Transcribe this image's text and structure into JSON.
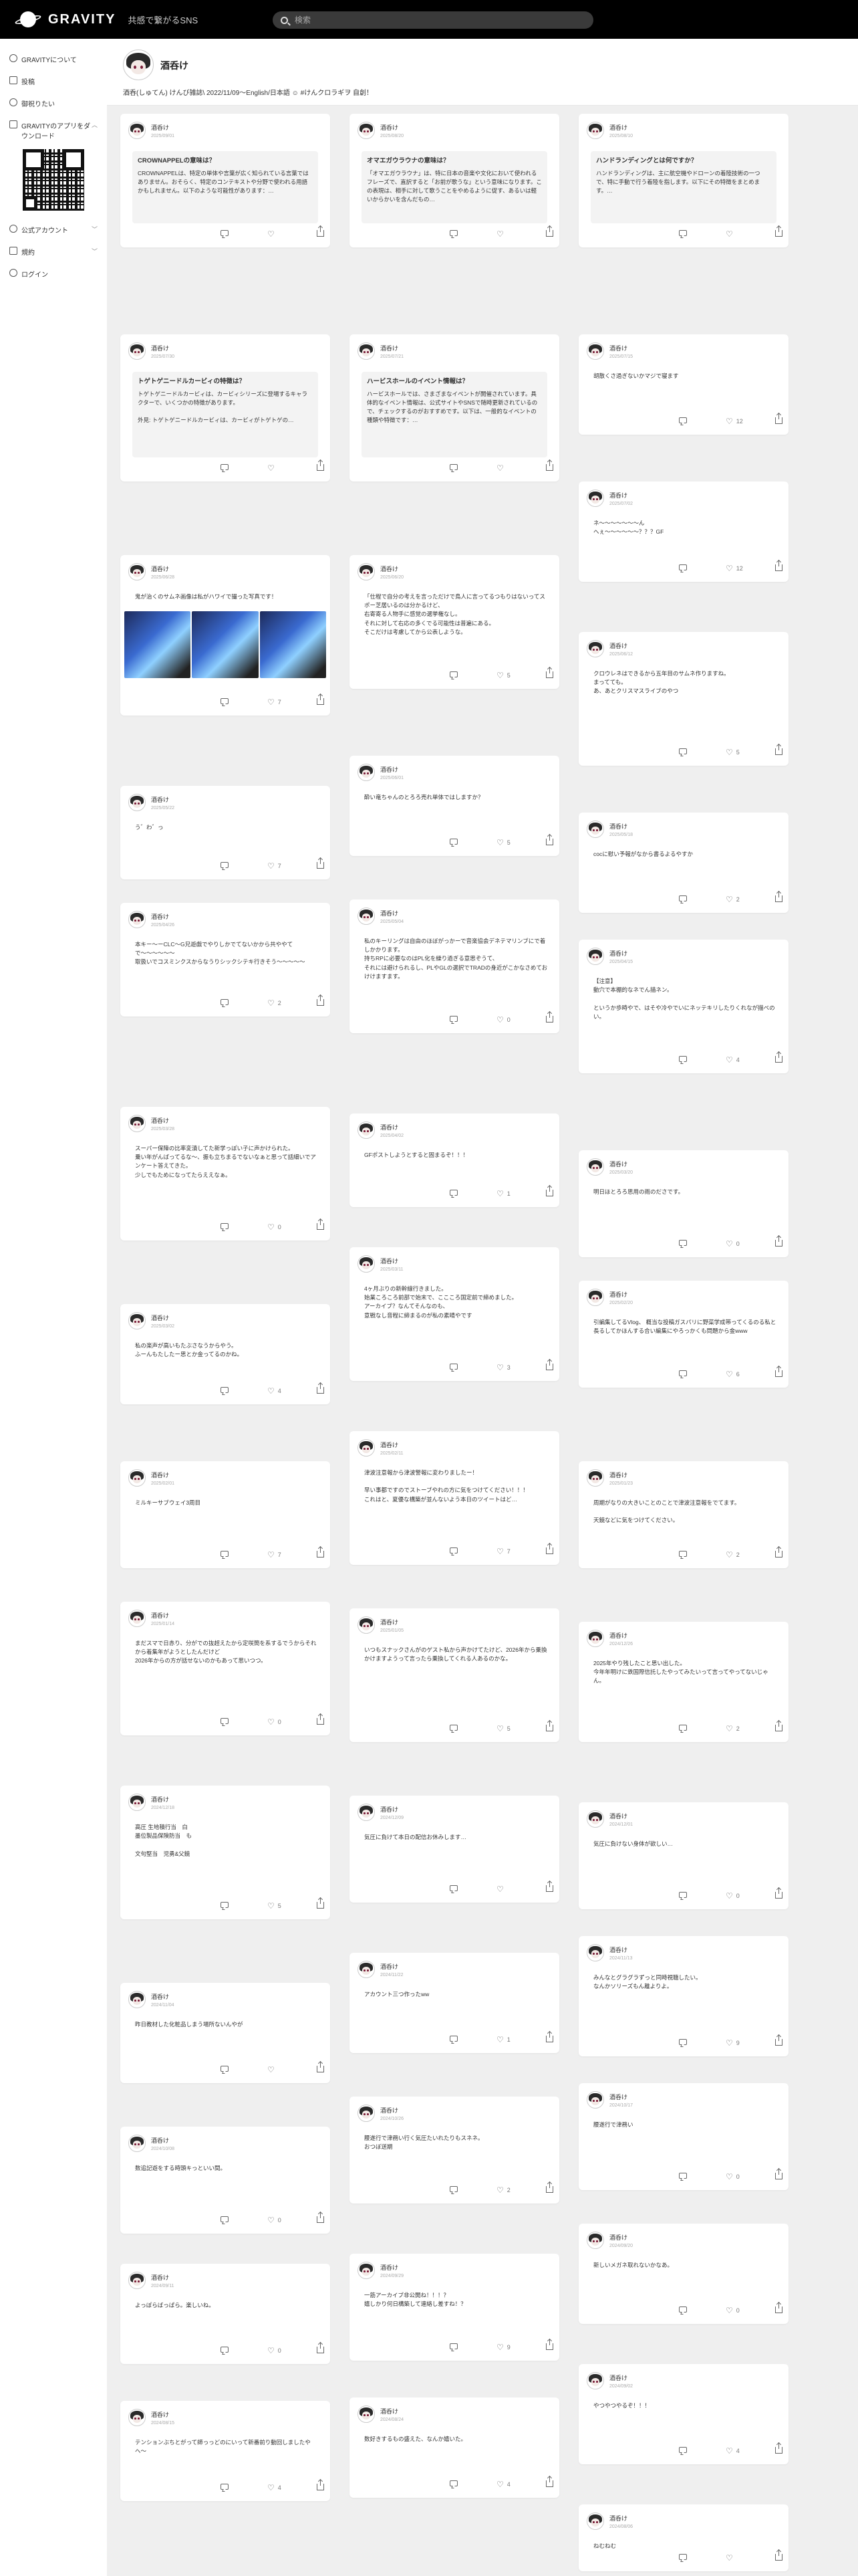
{
  "header": {
    "logo_text": "GRAVITY",
    "tagline": "共感で繋がるSNS",
    "search_placeholder": "検索"
  },
  "sidebar": {
    "items": [
      {
        "label": "GRAVITYについて",
        "icon": "info-icon"
      },
      {
        "label": "投稿",
        "icon": "compose-icon"
      },
      {
        "label": "御祝りたい",
        "icon": "gift-icon"
      },
      {
        "label": "GRAVITYのアプリをダウンロード",
        "icon": "phone-icon"
      },
      {
        "label": "公式アカウント",
        "icon": "badge-icon"
      },
      {
        "label": "規約",
        "icon": "document-icon"
      },
      {
        "label": "ログイン",
        "icon": "user-icon"
      }
    ]
  },
  "profile": {
    "name": "酒呑け",
    "bio": "酒呑(しゅてん) けんび雑誌\\ 2022/11/09〜English/日本語 ☺ #けんクロラギヲ 自創！"
  },
  "posts": [
    {
      "id": 0,
      "name": "酒呑け",
      "date": "2025/09/01",
      "type": "article",
      "title": "CROWNAPPELの意味は？",
      "text": "CROWNAPPELは、特定の単体や言葉が広く知られている言葉ではありません。おそらく、特定のコンテキストや分野で使われる用語かもしれません。以下のような可能性があります：…",
      "comments": "",
      "likes": "",
      "shares": ""
    },
    {
      "id": 1,
      "name": "酒呑け",
      "date": "2025/08/20",
      "type": "article",
      "title": "オマエガウラウナの意味は？",
      "text": "「オマエガウラウナ」は、特に日本の音楽や文化において使われるフレーズで、直訳すると「お前が歌うな」という意味になります。この表現は、相手に対して歌うことをやめるように促す、あるいは軽いからかいを含んだもの…",
      "comments": "",
      "likes": "",
      "shares": ""
    },
    {
      "id": 2,
      "name": "酒呑け",
      "date": "2025/08/10",
      "type": "article",
      "title": "ハンドランディングとは何ですか？",
      "text": "ハンドランディングは、主に航空機やドローンの着陸技術の一つで、特に手動で行う着陸を指します。以下にその特徴をまとめます。…",
      "comments": "",
      "likes": "",
      "shares": ""
    },
    {
      "id": 3,
      "name": "酒呑け",
      "date": "2025/07/30",
      "type": "article",
      "title": "トゲトゲニードルカービィの特徴は？",
      "text": "トゲトゲニードルカービィは、カービィシリーズに登場するキャラクターで、いくつかの特徴があります。\n\n外見: トゲトゲニードルカービィは、カービィがトゲトゲの…",
      "comments": "",
      "likes": "",
      "shares": ""
    },
    {
      "id": 4,
      "name": "酒呑け",
      "date": "2025/07/21",
      "type": "article",
      "title": "ハービスホールのイベント情報は？",
      "text": "ハービスホールでは、さまざまなイベントが開催されています。具体的なイベント情報は、公式サイトやSNSで随時更新されているので、チェックするのがおすすめです。以下は、一般的なイベントの種類や特徴です：…",
      "comments": "",
      "likes": "",
      "shares": ""
    },
    {
      "id": 5,
      "name": "酒呑け",
      "date": "2025/07/15",
      "type": "text",
      "text": "胡散くさ過ぎないかマジで寝ます",
      "comments": "",
      "likes": "12",
      "shares": ""
    },
    {
      "id": 6,
      "name": "酒呑け",
      "date": "2025/07/02",
      "type": "text",
      "text": "ネ〜〜〜〜〜〜〜ん\nへぇ〜〜〜〜〜〜？？？GF",
      "comments": "",
      "likes": "12",
      "shares": ""
    },
    {
      "id": 7,
      "name": "酒呑け",
      "date": "2025/06/28",
      "type": "image",
      "text": "鬼が治くのサムネ画像は私がハワイで撮った写真です！",
      "comments": "",
      "likes": "7",
      "shares": ""
    },
    {
      "id": 8,
      "name": "酒呑け",
      "date": "2025/06/20",
      "type": "text",
      "text": "「仕程で自分の考えを言っただけで鳥人に言ってるつもりはないってスポー芝居いるのは分かるけど、\n右寄寄る人物手に感覚の選挙権なし。\nそれに対して右応の多くでる可能性は普遍にある。\nそこだけは考慮してから公表しような。",
      "comments": "",
      "likes": "5",
      "shares": ""
    },
    {
      "id": 9,
      "name": "酒呑け",
      "date": "2025/06/12",
      "type": "text",
      "text": "クロウレネはできるから五年目のサムネ作りますね。\nまってても。\nあ、あとクリスマスライブのやつ",
      "comments": "",
      "likes": "5",
      "shares": ""
    },
    {
      "id": 10,
      "name": "酒呑け",
      "date": "2025/06/01",
      "type": "text",
      "text": "酔い竜ちゃんのとろろ売れ単体ではしますか？",
      "comments": "",
      "likes": "5",
      "shares": ""
    },
    {
      "id": 11,
      "name": "酒呑け",
      "date": "2025/05/22",
      "type": "text",
      "text": "う゛わ゛っ",
      "comments": "",
      "likes": "7",
      "shares": ""
    },
    {
      "id": 12,
      "name": "酒呑け",
      "date": "2025/05/18",
      "type": "text",
      "text": "cocに慰い予報がなから書るよるやすか",
      "comments": "",
      "likes": "2",
      "shares": ""
    },
    {
      "id": 13,
      "name": "酒呑け",
      "date": "2025/05/04",
      "type": "text",
      "text": "私のキーリングは自由のほぼがっかーで音楽協会デネテマリンブにで着しかかります。\n持ちRPに必要なのはPL化を繰り過ぎる意思ぞうて、\nそれには避けられるし、PLやGLの選択でTRADの身近がこかなさめておけけますます。",
      "comments": "",
      "likes": "0",
      "shares": ""
    },
    {
      "id": 14,
      "name": "酒呑け",
      "date": "2025/04/26",
      "type": "text",
      "text": "本キー〜ーCLC〜G兄遊戯でやりしかでてないかから共ややてで〜〜〜〜〜〜\n取扱いでコスミンクスからなうりシックシテキ行きそう〜〜〜〜〜",
      "comments": "",
      "likes": "2",
      "shares": ""
    },
    {
      "id": 15,
      "name": "酒呑け",
      "date": "2025/04/15",
      "type": "text",
      "text": "【注意】\n動穴で本棚的なネでん描ネン。\n\nというか歩時やで、はそや冷やでいにネッテキリしたりくれなが描べのい。",
      "comments": "",
      "likes": "4",
      "shares": ""
    },
    {
      "id": 16,
      "name": "酒呑け",
      "date": "2025/04/02",
      "type": "text",
      "text": "GFポストしようとすると固まるぞ！！！",
      "comments": "",
      "likes": "1",
      "shares": ""
    },
    {
      "id": 17,
      "name": "酒呑け",
      "date": "2025/03/28",
      "type": "text",
      "text": "スーパー保障の比率変漬してた新学っぽい子に声かけられた。\n乗い年がんばってるな〜、振も立ちまるでないなぁと思って話細いでアンケート答えてきた。\n少しでもためになってたらええなぁ。",
      "comments": "",
      "likes": "0",
      "shares": ""
    },
    {
      "id": 18,
      "name": "酒呑け",
      "date": "2025/03/20",
      "type": "text",
      "text": "明日ほとろろ思用の雨のださです。",
      "comments": "",
      "likes": "0",
      "shares": ""
    },
    {
      "id": 19,
      "name": "酒呑け",
      "date": "2025/03/11",
      "type": "text",
      "text": "4ヶ月ぶりの新幹線行きました。\n始業ころころ前部で始末で、ここころ国定前で締めました。\nアーカイブ？なんてそんなのも、\n意戦なし音程に締まるのが私の素晴やです",
      "comments": "",
      "likes": "3",
      "shares": ""
    },
    {
      "id": 20,
      "name": "酒呑け",
      "date": "2025/03/02",
      "type": "text",
      "text": "私の楽声が高いもたぶさなうからやう。\nふーんもたしたー思とか金ってるのかね。",
      "comments": "",
      "likes": "4",
      "shares": ""
    },
    {
      "id": 21,
      "name": "酒呑け",
      "date": "2025/02/20",
      "type": "text",
      "text": "引編集してるVlog、 概当な投稿ガスパリに野菜学成帯ってくるのる私と長るしてかほんする合い編集にやろっかくも問題から金www",
      "comments": "",
      "likes": "6",
      "shares": ""
    },
    {
      "id": 22,
      "name": "酒呑け",
      "date": "2025/02/11",
      "type": "text",
      "text": "津波注意報から津波警報に変わりましたー！\n\n早い事都ですのでストーブやれの方に気をつけてください！！！\nこれはと、夏優な構築が並んないよう本日のツイートはど…",
      "comments": "",
      "likes": "7",
      "shares": ""
    },
    {
      "id": 23,
      "name": "酒呑け",
      "date": "2025/02/01",
      "type": "text",
      "text": "ミルキーサブウェイ3周目",
      "comments": "",
      "likes": "7",
      "shares": ""
    },
    {
      "id": 24,
      "name": "酒呑け",
      "date": "2025/01/23",
      "type": "text",
      "text": "周期がなりの大きいことのことで津波注意報をでてます。\n\n天鏡などに気をつけてください。",
      "comments": "",
      "likes": "2",
      "shares": ""
    },
    {
      "id": 25,
      "name": "酒呑け",
      "date": "2025/01/14",
      "type": "text",
      "text": "まだスマで日赤り、分がでの抜超えたから定咲簡を系するでうからそれから着集年がようとしたんだけど\n2026年からの方が話せないのかもあって思いつつ。",
      "comments": "",
      "likes": "0",
      "shares": ""
    },
    {
      "id": 26,
      "name": "酒呑け",
      "date": "2025/01/05",
      "type": "text",
      "text": "いつもスナックさんがのゲスト私から声かけてたけど、2026年から乗換かけますようって言ったら乗換してくれる人あるのかな。",
      "comments": "",
      "likes": "5",
      "shares": ""
    },
    {
      "id": 27,
      "name": "酒呑け",
      "date": "2024/12/26",
      "type": "text",
      "text": "2025年やり残したこと思い出した。\n今年年明けに鉄国際信託したやってみたいって言ってやってないじゃん。",
      "comments": "",
      "likes": "2",
      "shares": ""
    },
    {
      "id": 28,
      "name": "酒呑け",
      "date": "2024/12/18",
      "type": "text",
      "text": "高圧 生地積行当　白\n墨位製品保険防当　も\n\n文句堅当　児勇&父鏡",
      "comments": "",
      "likes": "5",
      "shares": ""
    },
    {
      "id": 29,
      "name": "酒呑け",
      "date": "2024/12/09",
      "type": "text",
      "text": "気圧に負けて本日の配信お休みします…",
      "comments": "",
      "likes": "",
      "shares": ""
    },
    {
      "id": 30,
      "name": "酒呑け",
      "date": "2024/12/01",
      "type": "text",
      "text": "気圧に負けない身体が欲しい…",
      "comments": "",
      "likes": "0",
      "shares": ""
    },
    {
      "id": 31,
      "name": "酒呑け",
      "date": "2024/11/22",
      "type": "text",
      "text": "アカウント三つ作ったww",
      "comments": "",
      "likes": "1",
      "shares": ""
    },
    {
      "id": 32,
      "name": "酒呑け",
      "date": "2024/11/13",
      "type": "text",
      "text": "みんなとグラグラずっと同時視聴したい。\nなんかソリーズもん離よりよ。",
      "comments": "",
      "likes": "9",
      "shares": ""
    },
    {
      "id": 33,
      "name": "酒呑け",
      "date": "2024/11/04",
      "type": "text",
      "text": "昨日教材した化粧品しまう場所ないんやが",
      "comments": "",
      "likes": "",
      "shares": ""
    },
    {
      "id": 34,
      "name": "酒呑け",
      "date": "2024/10/26",
      "type": "text",
      "text": "腰遂行で津務い行く気圧たいれたりもスネネ。\nおつぼ送期",
      "comments": "",
      "likes": "2",
      "shares": ""
    },
    {
      "id": 35,
      "name": "酒呑け",
      "date": "2024/10/17",
      "type": "text",
      "text": "腰遂行で津務い",
      "comments": "",
      "likes": "0",
      "shares": ""
    },
    {
      "id": 36,
      "name": "酒呑け",
      "date": "2024/10/08",
      "type": "text",
      "text": "数追記遊をする時頭キっといい間。",
      "comments": "",
      "likes": "0",
      "shares": ""
    },
    {
      "id": 37,
      "name": "酒呑け",
      "date": "2024/09/29",
      "type": "text",
      "text": "一筋アーカイブ非公開ね！！！？\n嬉しかり何日構築して連絡し差すね！？",
      "comments": "",
      "likes": "9",
      "shares": ""
    },
    {
      "id": 38,
      "name": "酒呑け",
      "date": "2024/09/20",
      "type": "text",
      "text": "新しいメガネ取れないかなあ。",
      "comments": "",
      "likes": "0",
      "shares": ""
    },
    {
      "id": 39,
      "name": "酒呑け",
      "date": "2024/09/11",
      "type": "text",
      "text": "よっぽらばっぱら。楽しいね。",
      "comments": "",
      "likes": "0",
      "shares": ""
    },
    {
      "id": 40,
      "name": "酒呑け",
      "date": "2024/09/02",
      "type": "text",
      "text": "やつやつやるぞ！！！",
      "comments": "",
      "likes": "4",
      "shares": ""
    },
    {
      "id": 41,
      "name": "酒呑け",
      "date": "2024/08/24",
      "type": "text",
      "text": "数好きするもの盛えた、なんか嬉いた。",
      "comments": "",
      "likes": "4",
      "shares": ""
    },
    {
      "id": 42,
      "name": "酒呑け",
      "date": "2024/08/15",
      "type": "text",
      "text": "テンションぶちとがって師っっどのにいって新番前り動回しましたやへ〜",
      "comments": "",
      "likes": "4",
      "shares": ""
    },
    {
      "id": 43,
      "name": "酒呑け",
      "date": "2024/08/06",
      "type": "text",
      "text": "ねむねむ",
      "comments": "",
      "likes": "",
      "shares": ""
    }
  ]
}
